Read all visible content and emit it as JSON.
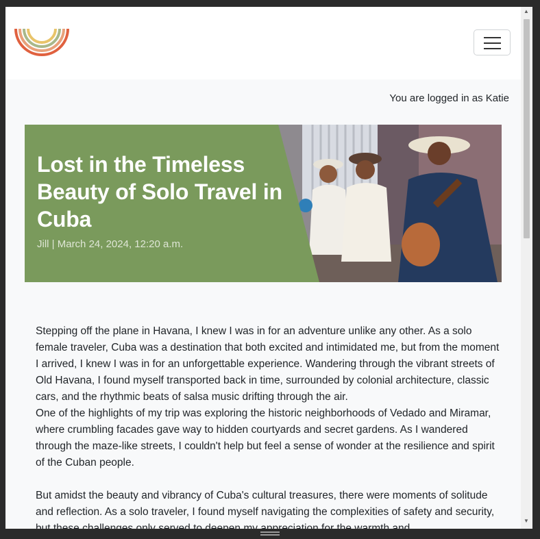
{
  "header": {
    "logo_icon": "rainbow-arch-logo",
    "menu_icon": "hamburger-menu-icon"
  },
  "user": {
    "login_status": "You are logged in as Katie"
  },
  "post": {
    "title": "Lost in the Timeless Beauty of Solo Travel in Cuba",
    "meta": "Jill | March 24, 2024, 12:20 a.m.",
    "paragraphs": [
      "Stepping off the plane in Havana, I knew I was in for an adventure unlike any other. As a solo female traveler, Cuba was a destination that both excited and intimidated me, but from the moment I arrived, I knew I was in for an unforgettable experience. Wandering through the vibrant streets of Old Havana, I found myself transported back in time, surrounded by colonial architecture, classic cars, and the rhythmic beats of salsa music drifting through the air.",
      "One of the highlights of my trip was exploring the historic neighborhoods of Vedado and Miramar, where crumbling facades gave way to hidden courtyards and secret gardens. As I wandered through the maze-like streets, I couldn't help but feel a sense of wonder at the resilience and spirit of the Cuban people.",
      "But amidst the beauty and vibrancy of Cuba's cultural treasures, there were moments of solitude and reflection. As a solo traveler, I found myself navigating the complexities of safety and security, but these challenges only served to deepen my appreciation for the warmth and"
    ]
  },
  "colors": {
    "hero_panel": "#7a9a5c",
    "page_background": "#f8f9fa"
  }
}
